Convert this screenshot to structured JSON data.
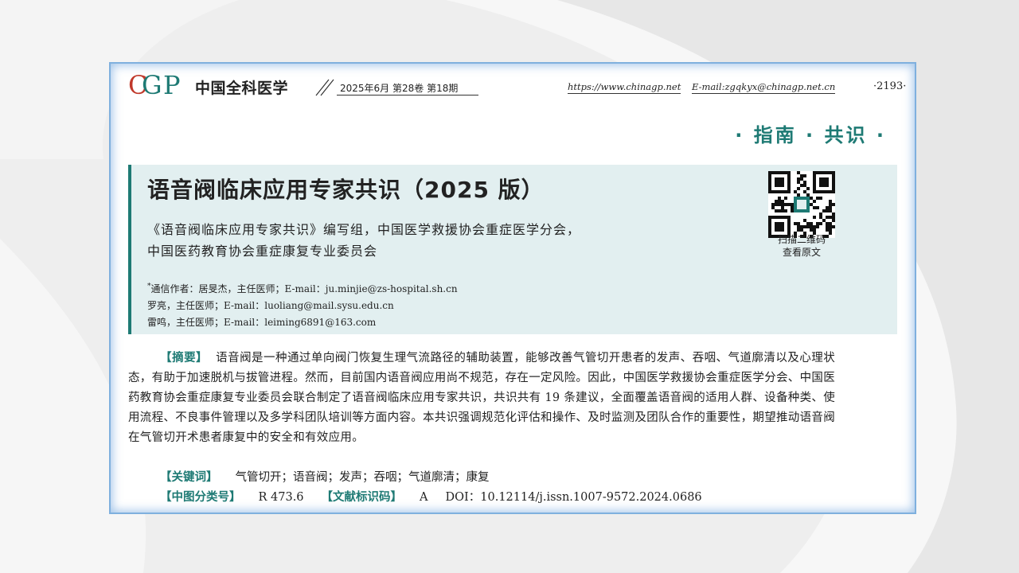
{
  "header": {
    "logo_text": "CGP",
    "journal_name": "中国全科医学",
    "issue": "2025年6月  第28卷  第18期",
    "url": "https://www.chinagp.net",
    "email": "E-mail:zgqkyx@chinagp.net.cn",
    "page_number": "·2193·"
  },
  "section_label": "· 指南 · 共识 ·",
  "article": {
    "title": "语音阀临床应用专家共识（2025 版）",
    "authors_line1": "《语音阀临床应用专家共识》编写组，中国医学救援协会重症医学分会，",
    "authors_line2": "中国医药教育协会重症康复专业委员会",
    "correspondence": [
      {
        "marker": "*",
        "text": "通信作者：居旻杰，主任医师；E-mail：ju.minjie@zs-hospital.sh.cn"
      },
      {
        "marker": "",
        "text": "罗亮，主任医师；E-mail：luoliang@mail.sysu.edu.cn"
      },
      {
        "marker": "",
        "text": "雷鸣，主任医师；E-mail：leiming6891@163.com"
      }
    ],
    "qr_caption_1": "扫描二维码",
    "qr_caption_2": "查看原文"
  },
  "abstract": {
    "label": "【摘要】",
    "text": "语音阀是一种通过单向阀门恢复生理气流路径的辅助装置，能够改善气管切开患者的发声、吞咽、气道廓清以及心理状态，有助于加速脱机与拔管进程。然而，目前国内语音阀应用尚不规范，存在一定风险。因此，中国医学救援协会重症医学分会、中国医药教育协会重症康复专业委员会联合制定了语音阀临床应用专家共识，共识共有 19 条建议，全面覆盖语音阀的适用人群、设备种类、使用流程、不良事件管理以及多学科团队培训等方面内容。本共识强调规范化评估和操作、及时监测及团队合作的重要性，期望推动语音阀在气管切开术患者康复中的安全和有效应用。"
  },
  "keywords": {
    "label": "【关键词】",
    "text": "气管切开；语音阀；发声；吞咽；气道廓清；康复"
  },
  "classification": {
    "clc_label": "【中图分类号】",
    "clc_value": "R 473.6",
    "doc_label": "【文献标识码】",
    "doc_value": "A",
    "doi": "DOI：10.12114/j.issn.1007-9572.2024.0686"
  },
  "colors": {
    "accent": "#1e7a74",
    "title_box_bg": "#e2eff0",
    "frame_glow": "#7fb0de"
  }
}
